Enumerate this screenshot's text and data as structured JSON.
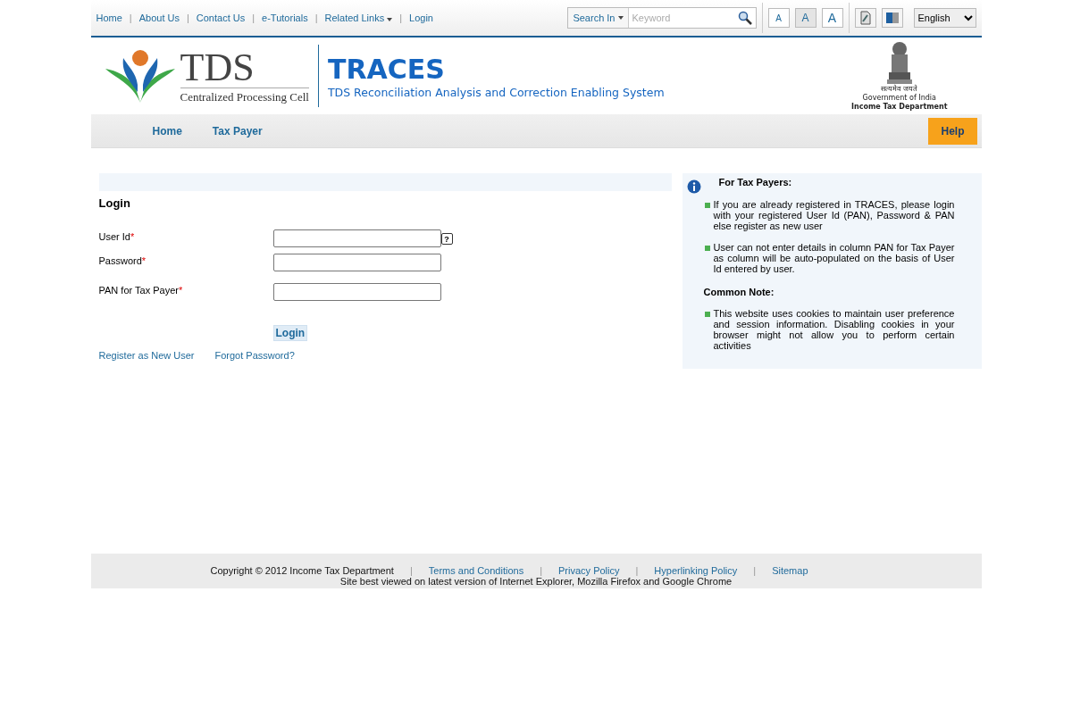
{
  "top_links": [
    {
      "label": "Home",
      "dropdown": false
    },
    {
      "separator": "|",
      "label": "About Us",
      "dropdown": false
    },
    {
      "separator": "|",
      "label": "Contact Us",
      "dropdown": false
    },
    {
      "separator": "|",
      "label": "e-Tutorials",
      "dropdown": false
    },
    {
      "separator": "|",
      "label": "Related Links",
      "dropdown": true
    },
    {
      "separator": "|",
      "label": "Login",
      "dropdown": false
    }
  ],
  "search": {
    "scope": "Search In",
    "placeholder": "Keyword"
  },
  "font_sizes": [
    {
      "label": "A",
      "selected": false
    },
    {
      "label": "A",
      "selected": true
    },
    {
      "label": "A",
      "selected": false
    }
  ],
  "language": "English",
  "logo": {
    "acronym": "TDS",
    "subtitle": "Centralized Processing Cell"
  },
  "brand": {
    "title": "TRACES",
    "subtitle": "TDS Reconciliation Analysis and Correction Enabling System"
  },
  "emblem": {
    "motto": "सत्यमेव जयते",
    "line_1": "Government of India",
    "line_2": "Income Tax Department"
  },
  "nav": [
    {
      "label": "Home"
    },
    {
      "label": "Tax Payer"
    }
  ],
  "help": "Help",
  "form": {
    "title": "Login",
    "fields": [
      {
        "label": "User Id",
        "mark": "*",
        "help": "?"
      },
      {
        "label": "Password",
        "mark": "*"
      },
      {
        "label": "PAN for Tax Payer",
        "mark": "*"
      }
    ],
    "submit": "Login",
    "links": [
      "Register as New User",
      "Forgot Password?"
    ]
  },
  "info": {
    "heading": "For Tax Payers:",
    "items": [
      "If you are already registered in TRACES, please login with your registered User Id (PAN), Password & PAN else register as new user",
      "User can not enter details in column PAN for Tax Payer as column will be auto-populated on the basis of User Id entered by user."
    ],
    "note_heading": "Common Note:",
    "notes": [
      "This website uses cookies to maintain user preference and session information. Disabling cookies in your browser might not allow you to perform certain activities"
    ]
  },
  "footer": {
    "copyright": "Copyright © 2012 Income Tax Department",
    "links": [
      {
        "separator": "|",
        "label": "Terms and Conditions"
      },
      {
        "separator": "|",
        "label": "Privacy Policy"
      },
      {
        "separator": "|",
        "label": "Hyperlinking Policy"
      },
      {
        "separator": "|",
        "label": "Sitemap"
      }
    ],
    "note": "Site best viewed on latest version of Internet Explorer, Mozilla Firefox and Google Chrome"
  }
}
